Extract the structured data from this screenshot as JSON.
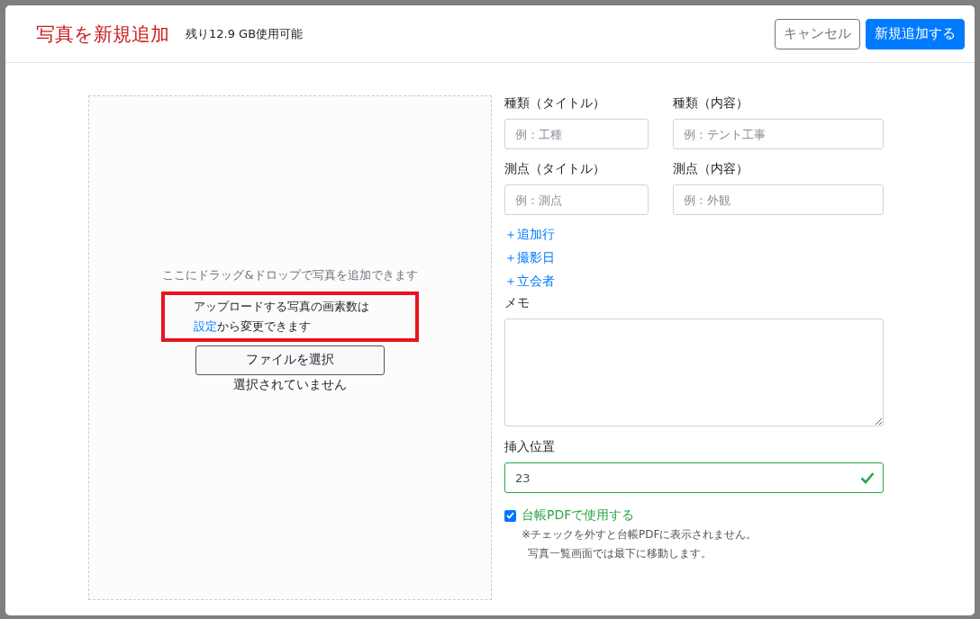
{
  "modal": {
    "title": "写真を新規追加",
    "storage": "残り12.9 GB使用可能",
    "buttons": [
      {
        "kind": "secondary",
        "label": "キャンセル"
      },
      {
        "kind": "primary",
        "label": "新規追加する"
      }
    ]
  },
  "dropzone": {
    "hint": "ここにドラッグ&ドロップで写真を追加できます",
    "note": {
      "text": "アップロードする写真の画素数は",
      "link": "設定",
      "rest": "から変更できます",
      "highlighted": true
    },
    "file_button": "ファイルを選択",
    "file_status": "選択されていません"
  },
  "fields": [
    {
      "label": "種類（タイトル）",
      "placeholder": "例：工種"
    },
    {
      "label": "種類（内容）",
      "placeholder": "例：テント工事"
    },
    {
      "label": "測点（タイトル）",
      "placeholder": "例：測点"
    },
    {
      "label": "測点（内容）",
      "placeholder": "例：外観"
    }
  ],
  "add_links": [
    {
      "icon": "＋",
      "label": "追加行"
    },
    {
      "icon": "＋",
      "label": "撮影日"
    },
    {
      "icon": "＋",
      "label": "立会者"
    }
  ],
  "memo": {
    "label": "メモ"
  },
  "position": {
    "label": "挿入位置",
    "value": "23",
    "valid": true
  },
  "pdf": {
    "label": "台帳PDFで使用する",
    "checked": true,
    "notes": [
      "※チェックを外すと台帳PDFに表示されません。",
      "写真一覧画面では最下に移動します。"
    ]
  }
}
